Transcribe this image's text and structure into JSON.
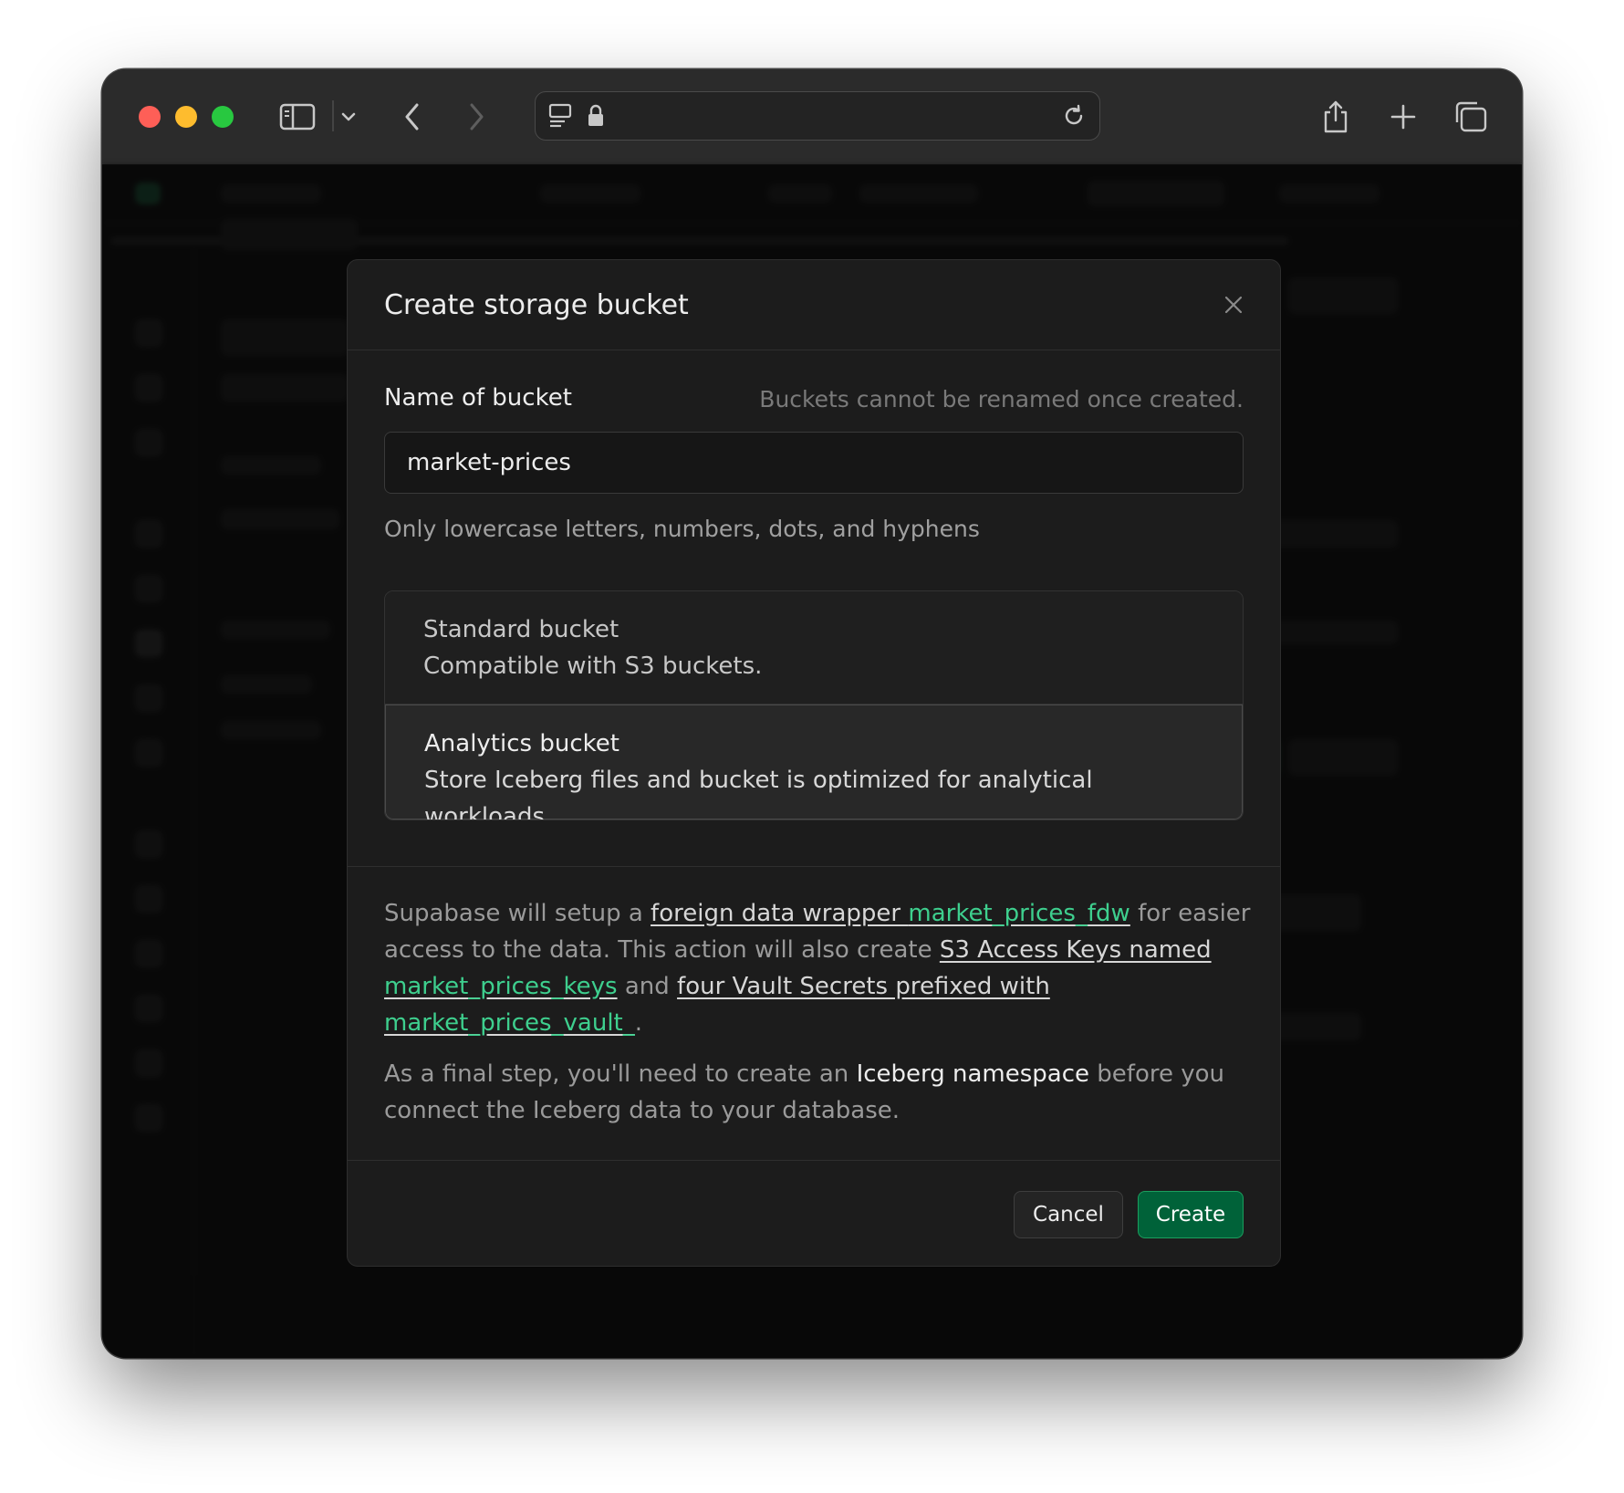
{
  "browser": {
    "traffic_lights": [
      "close",
      "minimize",
      "zoom"
    ],
    "url": ""
  },
  "modal": {
    "title": "Create storage bucket",
    "name_label": "Name of bucket",
    "name_note": "Buckets cannot be renamed once created.",
    "name_value": "market-prices",
    "name_help": "Only lowercase letters, numbers, dots, and hyphens",
    "bucket_types": [
      {
        "title": "Standard bucket",
        "description": "Compatible with S3 buckets.",
        "selected": false
      },
      {
        "title": "Analytics bucket",
        "description": "Store Iceberg files and bucket is optimized for analytical workloads.",
        "selected": true
      }
    ],
    "info": {
      "p1_prefix": "Supabase will setup a ",
      "p1_link1_text": "foreign data wrapper ",
      "p1_link1_code": "market_prices_fdw",
      "p1_mid": " for easier access to the data. This action will also create ",
      "p1_link2_text": "S3 Access Keys named ",
      "p1_link2_code": "market_prices_keys",
      "p1_and": " and ",
      "p1_link3_text": "four Vault Secrets prefixed with ",
      "p1_link3_code": "market_prices_vault_",
      "p1_end": ".",
      "p2_prefix": "As a final step, you'll need to create an ",
      "p2_strong": "Iceberg namespace",
      "p2_suffix": " before you connect the Iceberg data to your database."
    },
    "cancel_label": "Cancel",
    "create_label": "Create"
  },
  "colors": {
    "accent_green": "#3ecf8e",
    "button_green": "#006239",
    "modal_bg": "#1c1c1c"
  }
}
